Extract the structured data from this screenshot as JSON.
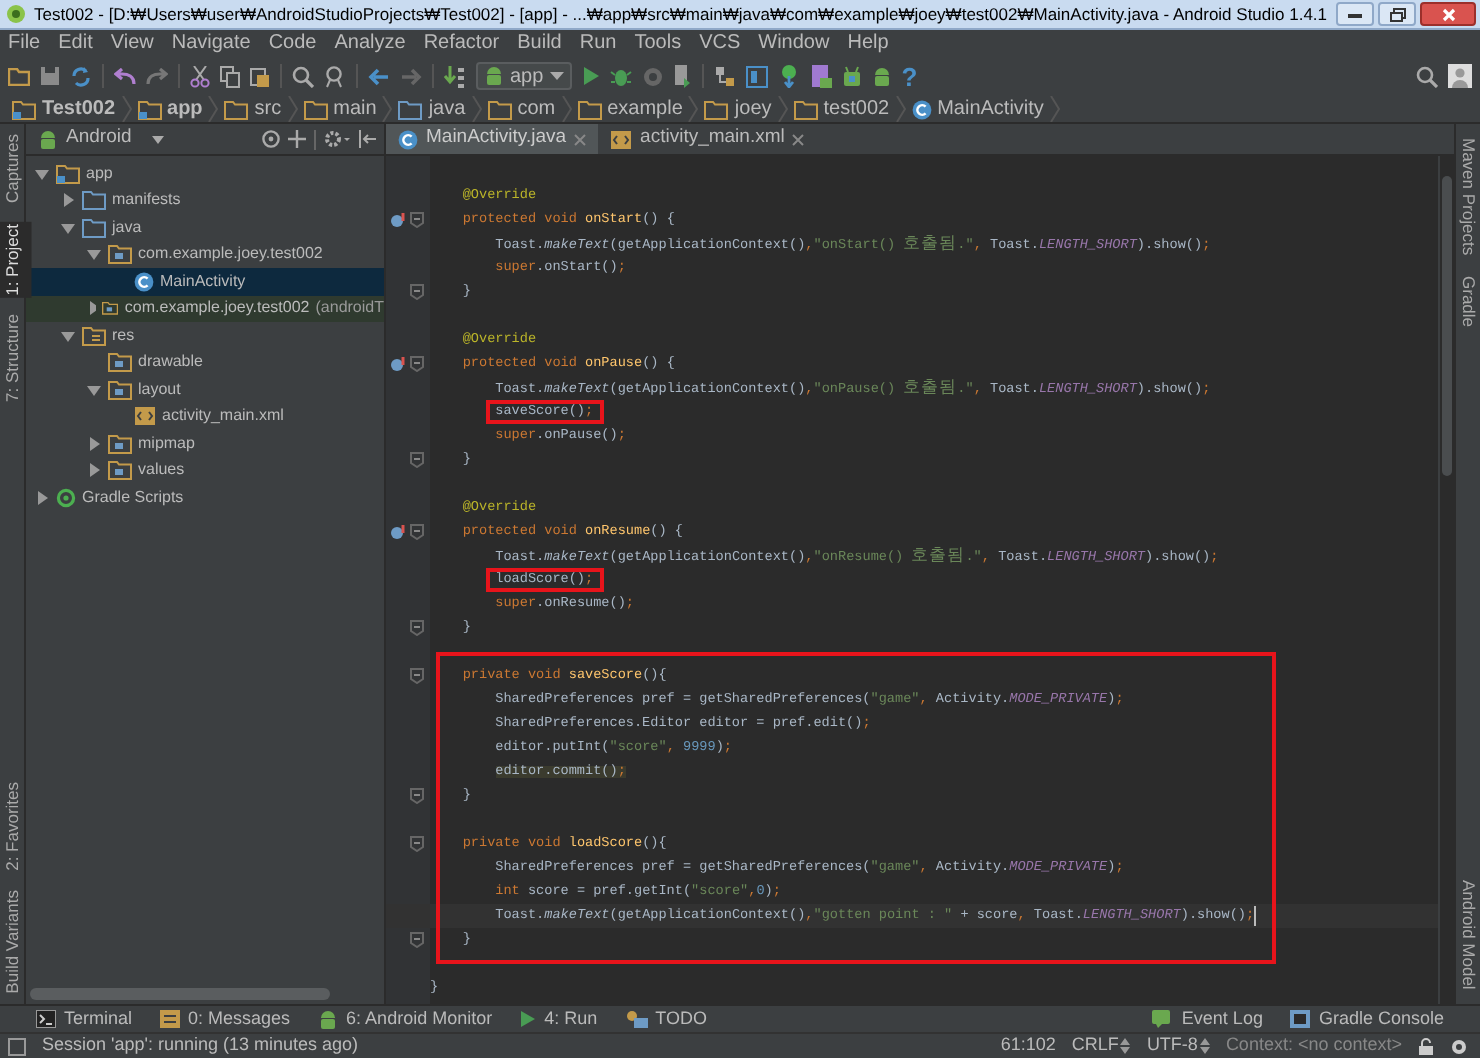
{
  "window": {
    "title": "Test002 - [D:₩Users₩user₩AndroidStudioProjects₩Test002] - [app] - ...₩app₩src₩main₩java₩com₩example₩joey₩test002₩MainActivity.java - Android Studio 1.4.1"
  },
  "menu": [
    "File",
    "Edit",
    "View",
    "Navigate",
    "Code",
    "Analyze",
    "Refactor",
    "Build",
    "Run",
    "Tools",
    "VCS",
    "Window",
    "Help"
  ],
  "toolbar": {
    "run_config": "app",
    "help": "?"
  },
  "breadcrumbs": [
    {
      "label": "Test002",
      "kind": "project"
    },
    {
      "label": "app",
      "kind": "module"
    },
    {
      "label": "src",
      "kind": "folder"
    },
    {
      "label": "main",
      "kind": "folder"
    },
    {
      "label": "java",
      "kind": "source_folder"
    },
    {
      "label": "com",
      "kind": "folder"
    },
    {
      "label": "example",
      "kind": "folder"
    },
    {
      "label": "joey",
      "kind": "folder"
    },
    {
      "label": "test002",
      "kind": "folder"
    },
    {
      "label": "MainActivity",
      "kind": "class"
    }
  ],
  "left_tool_strip": {
    "top": [
      {
        "label": "Captures",
        "selected": false
      },
      {
        "label": "1: Project",
        "selected": true
      },
      {
        "label": "7: Structure",
        "selected": false
      }
    ],
    "bottom": [
      {
        "label": "2: Favorites",
        "selected": false
      },
      {
        "label": "Build Variants",
        "selected": false
      }
    ]
  },
  "project_panel": {
    "view": "Android",
    "tree": [
      {
        "label": "app",
        "kind": "module",
        "expanded": true,
        "selected": false,
        "children": [
          {
            "label": "manifests",
            "kind": "source_folder",
            "expanded": false,
            "selected": false
          },
          {
            "label": "java",
            "kind": "source_folder",
            "expanded": true,
            "selected": false,
            "children": [
              {
                "label": "com.example.joey.test002",
                "kind": "package",
                "expanded": true,
                "selected": false,
                "children": [
                  {
                    "label": "MainActivity",
                    "kind": "class",
                    "selected": true
                  }
                ]
              },
              {
                "label": "com.example.joey.test002",
                "suffix": "(androidT",
                "kind": "test_package",
                "expanded": false,
                "selected": false
              }
            ]
          },
          {
            "label": "res",
            "kind": "res_folder",
            "expanded": true,
            "selected": false,
            "children": [
              {
                "label": "drawable",
                "kind": "package",
                "selected": false
              },
              {
                "label": "layout",
                "kind": "package",
                "expanded": true,
                "selected": false,
                "children": [
                  {
                    "label": "activity_main.xml",
                    "kind": "layout_file",
                    "selected": false
                  }
                ]
              },
              {
                "label": "mipmap",
                "kind": "package",
                "expanded": false,
                "selected": false
              },
              {
                "label": "values",
                "kind": "package",
                "expanded": false,
                "selected": false
              }
            ]
          }
        ]
      },
      {
        "label": "Gradle Scripts",
        "kind": "gradle",
        "expanded": false,
        "selected": false
      }
    ]
  },
  "editor": {
    "tabs": [
      {
        "label": "MainActivity.java",
        "kind": "class",
        "selected": true
      },
      {
        "label": "activity_main.xml",
        "kind": "layout_file",
        "selected": false
      }
    ],
    "lines": [
      {
        "kind": "blank"
      },
      {
        "kind": "code",
        "override": false,
        "fold": false,
        "segments": [
          {
            "text": "    @Override",
            "kind": "annotation"
          }
        ]
      },
      {
        "kind": "code",
        "override": true,
        "fold": true,
        "segments": [
          {
            "text": "    protected void ",
            "kind": "keyword"
          },
          {
            "text": "onStart",
            "kind": "declaration"
          },
          {
            "text": "() {",
            "kind": "plain"
          }
        ]
      },
      {
        "kind": "code",
        "override": false,
        "fold": false,
        "segments": [
          {
            "text": "        Toast.",
            "kind": "plain"
          },
          {
            "text": "makeText",
            "kind": "static_call"
          },
          {
            "text": "(getApplicationContext()",
            "kind": "plain"
          },
          {
            "text": ",",
            "kind": "keyword"
          },
          {
            "text": "\"onStart() 호출됨.\"",
            "kind": "string"
          },
          {
            "text": ", ",
            "kind": "keyword"
          },
          {
            "text": "Toast.",
            "kind": "plain"
          },
          {
            "text": "LENGTH_SHORT",
            "kind": "constant"
          },
          {
            "text": ").show()",
            "kind": "plain"
          },
          {
            "text": ";",
            "kind": "keyword"
          }
        ]
      },
      {
        "kind": "code",
        "override": false,
        "fold": false,
        "segments": [
          {
            "text": "        super",
            "kind": "keyword"
          },
          {
            "text": ".onStart()",
            "kind": "plain"
          },
          {
            "text": ";",
            "kind": "keyword"
          }
        ]
      },
      {
        "kind": "code",
        "override": false,
        "fold": true,
        "segments": [
          {
            "text": "    }",
            "kind": "plain"
          }
        ]
      },
      {
        "kind": "blank"
      },
      {
        "kind": "code",
        "override": false,
        "fold": false,
        "segments": [
          {
            "text": "    @Override",
            "kind": "annotation"
          }
        ]
      },
      {
        "kind": "code",
        "override": true,
        "fold": true,
        "segments": [
          {
            "text": "    protected void ",
            "kind": "keyword"
          },
          {
            "text": "onPause",
            "kind": "declaration"
          },
          {
            "text": "() {",
            "kind": "plain"
          }
        ]
      },
      {
        "kind": "code",
        "override": false,
        "fold": false,
        "segments": [
          {
            "text": "        Toast.",
            "kind": "plain"
          },
          {
            "text": "makeText",
            "kind": "static_call"
          },
          {
            "text": "(getApplicationContext()",
            "kind": "plain"
          },
          {
            "text": ",",
            "kind": "keyword"
          },
          {
            "text": "\"onPause() 호출됨.\"",
            "kind": "string"
          },
          {
            "text": ", ",
            "kind": "keyword"
          },
          {
            "text": "Toast.",
            "kind": "plain"
          },
          {
            "text": "LENGTH_SHORT",
            "kind": "constant"
          },
          {
            "text": ").show()",
            "kind": "plain"
          },
          {
            "text": ";",
            "kind": "keyword"
          }
        ]
      },
      {
        "kind": "code",
        "override": false,
        "fold": false,
        "boxed": true,
        "segments": [
          {
            "text": "        saveScore()",
            "kind": "plain"
          },
          {
            "text": ";",
            "kind": "keyword"
          }
        ]
      },
      {
        "kind": "code",
        "override": false,
        "fold": false,
        "segments": [
          {
            "text": "        super",
            "kind": "keyword"
          },
          {
            "text": ".onPause()",
            "kind": "plain"
          },
          {
            "text": ";",
            "kind": "keyword"
          }
        ]
      },
      {
        "kind": "code",
        "override": false,
        "fold": true,
        "segments": [
          {
            "text": "    }",
            "kind": "plain"
          }
        ]
      },
      {
        "kind": "blank"
      },
      {
        "kind": "code",
        "override": false,
        "fold": false,
        "segments": [
          {
            "text": "    @Override",
            "kind": "annotation"
          }
        ]
      },
      {
        "kind": "code",
        "override": true,
        "fold": true,
        "segments": [
          {
            "text": "    protected void ",
            "kind": "keyword"
          },
          {
            "text": "onResume",
            "kind": "declaration"
          },
          {
            "text": "() {",
            "kind": "plain"
          }
        ]
      },
      {
        "kind": "code",
        "override": false,
        "fold": false,
        "segments": [
          {
            "text": "        Toast.",
            "kind": "plain"
          },
          {
            "text": "makeText",
            "kind": "static_call"
          },
          {
            "text": "(getApplicationContext()",
            "kind": "plain"
          },
          {
            "text": ",",
            "kind": "keyword"
          },
          {
            "text": "\"onResume() 호출됨.\"",
            "kind": "string"
          },
          {
            "text": ", ",
            "kind": "keyword"
          },
          {
            "text": "Toast.",
            "kind": "plain"
          },
          {
            "text": "LENGTH_SHORT",
            "kind": "constant"
          },
          {
            "text": ").show()",
            "kind": "plain"
          },
          {
            "text": ";",
            "kind": "keyword"
          }
        ]
      },
      {
        "kind": "code",
        "override": false,
        "fold": false,
        "boxed": true,
        "segments": [
          {
            "text": "        loadScore()",
            "kind": "plain"
          },
          {
            "text": ";",
            "kind": "keyword"
          }
        ]
      },
      {
        "kind": "code",
        "override": false,
        "fold": false,
        "segments": [
          {
            "text": "        super",
            "kind": "keyword"
          },
          {
            "text": ".onResume()",
            "kind": "plain"
          },
          {
            "text": ";",
            "kind": "keyword"
          }
        ]
      },
      {
        "kind": "code",
        "override": false,
        "fold": true,
        "segments": [
          {
            "text": "    }",
            "kind": "plain"
          }
        ]
      },
      {
        "kind": "blank"
      },
      {
        "kind": "boxed_group",
        "lines": [
          {
            "kind": "code",
            "override": false,
            "fold": true,
            "segments": [
              {
                "text": "    private void ",
                "kind": "keyword"
              },
              {
                "text": "saveScore",
                "kind": "declaration"
              },
              {
                "text": "(){",
                "kind": "plain"
              }
            ]
          },
          {
            "kind": "code",
            "override": false,
            "fold": false,
            "segments": [
              {
                "text": "        SharedPreferences pref = getSharedPreferences(",
                "kind": "plain"
              },
              {
                "text": "\"game\"",
                "kind": "string"
              },
              {
                "text": ", ",
                "kind": "keyword"
              },
              {
                "text": "Activity.",
                "kind": "plain"
              },
              {
                "text": "MODE_PRIVATE",
                "kind": "constant"
              },
              {
                "text": ")",
                "kind": "plain"
              },
              {
                "text": ";",
                "kind": "keyword"
              }
            ]
          },
          {
            "kind": "code",
            "override": false,
            "fold": false,
            "segments": [
              {
                "text": "        SharedPreferences.Editor editor = pref.edit()",
                "kind": "plain"
              },
              {
                "text": ";",
                "kind": "keyword"
              }
            ]
          },
          {
            "kind": "code",
            "override": false,
            "fold": false,
            "segments": [
              {
                "text": "        editor.putInt(",
                "kind": "plain"
              },
              {
                "text": "\"score\"",
                "kind": "string"
              },
              {
                "text": ", ",
                "kind": "keyword"
              },
              {
                "text": "9999",
                "kind": "number"
              },
              {
                "text": ")",
                "kind": "plain"
              },
              {
                "text": ";",
                "kind": "keyword"
              }
            ]
          },
          {
            "kind": "code",
            "override": false,
            "fold": false,
            "highlighted": true,
            "segments": [
              {
                "text": "        editor.commit()",
                "kind": "plain"
              },
              {
                "text": ";",
                "kind": "keyword"
              }
            ]
          },
          {
            "kind": "code",
            "override": false,
            "fold": true,
            "segments": [
              {
                "text": "    }",
                "kind": "plain"
              }
            ]
          },
          {
            "kind": "blank"
          },
          {
            "kind": "code",
            "override": false,
            "fold": true,
            "segments": [
              {
                "text": "    private void ",
                "kind": "keyword"
              },
              {
                "text": "loadScore",
                "kind": "declaration"
              },
              {
                "text": "(){",
                "kind": "plain"
              }
            ]
          },
          {
            "kind": "code",
            "override": false,
            "fold": false,
            "segments": [
              {
                "text": "        SharedPreferences pref = getSharedPreferences(",
                "kind": "plain"
              },
              {
                "text": "\"game\"",
                "kind": "string"
              },
              {
                "text": ", ",
                "kind": "keyword"
              },
              {
                "text": "Activity.",
                "kind": "plain"
              },
              {
                "text": "MODE_PRIVATE",
                "kind": "constant"
              },
              {
                "text": ")",
                "kind": "plain"
              },
              {
                "text": ";",
                "kind": "keyword"
              }
            ]
          },
          {
            "kind": "code",
            "override": false,
            "fold": false,
            "segments": [
              {
                "text": "        int",
                "kind": "keyword"
              },
              {
                "text": " score = pref.getInt(",
                "kind": "plain"
              },
              {
                "text": "\"score\"",
                "kind": "string"
              },
              {
                "text": ",",
                "kind": "keyword"
              },
              {
                "text": "0",
                "kind": "number"
              },
              {
                "text": ")",
                "kind": "plain"
              },
              {
                "text": ";",
                "kind": "keyword"
              }
            ]
          },
          {
            "kind": "code",
            "override": false,
            "fold": false,
            "current": true,
            "segments": [
              {
                "text": "        Toast.",
                "kind": "plain"
              },
              {
                "text": "makeText",
                "kind": "static_call"
              },
              {
                "text": "(getApplicationContext()",
                "kind": "plain"
              },
              {
                "text": ",",
                "kind": "keyword"
              },
              {
                "text": "\"gotten point : \"",
                "kind": "string"
              },
              {
                "text": " + score",
                "kind": "plain"
              },
              {
                "text": ", ",
                "kind": "keyword"
              },
              {
                "text": "Toast.",
                "kind": "plain"
              },
              {
                "text": "LENGTH_SHORT",
                "kind": "constant"
              },
              {
                "text": ").show()",
                "kind": "plain"
              },
              {
                "text": ";",
                "kind": "keyword"
              }
            ]
          },
          {
            "kind": "code",
            "override": false,
            "fold": true,
            "segments": [
              {
                "text": "    }",
                "kind": "plain"
              }
            ]
          }
        ]
      },
      {
        "kind": "blank"
      },
      {
        "kind": "code",
        "override": false,
        "fold": false,
        "segments": [
          {
            "text": "}",
            "kind": "plain"
          }
        ]
      }
    ]
  },
  "right_tool_strip": {
    "top": [
      {
        "label": "Maven Projects",
        "selected": false
      },
      {
        "label": "Gradle",
        "selected": false
      }
    ],
    "bottom": [
      {
        "label": "Android Model",
        "selected": false
      }
    ]
  },
  "bottom_tool_bar": {
    "left": [
      {
        "label": "Terminal",
        "kind": "terminal"
      },
      {
        "label": "0: Messages",
        "kind": "messages"
      },
      {
        "label": "6: Android Monitor",
        "kind": "android"
      },
      {
        "label": "4: Run",
        "kind": "run"
      },
      {
        "label": "TODO",
        "kind": "todo"
      }
    ],
    "right": [
      {
        "label": "Event Log",
        "kind": "event_log"
      },
      {
        "label": "Gradle Console",
        "kind": "console"
      }
    ]
  },
  "status_bar": {
    "message": "Session 'app': running (13 minutes ago)",
    "position": "61:102",
    "line_separator": "CRLF",
    "encoding": "UTF-8",
    "context": "Context: <no context>"
  }
}
